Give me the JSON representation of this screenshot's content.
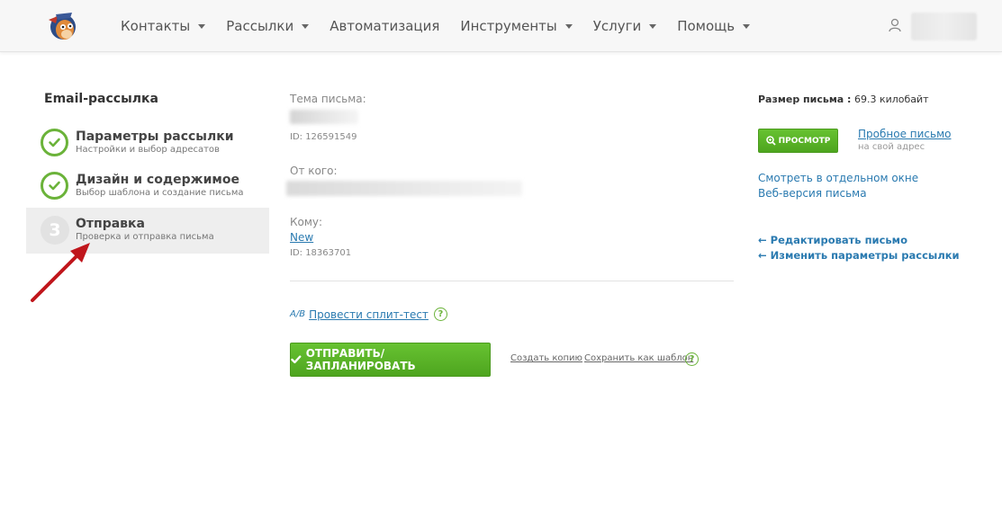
{
  "nav": {
    "items": [
      {
        "label": "Контакты",
        "dropdown": true
      },
      {
        "label": "Рассылки",
        "dropdown": true
      },
      {
        "label": "Автоматизация",
        "dropdown": false
      },
      {
        "label": "Инструменты",
        "dropdown": true
      },
      {
        "label": "Услуги",
        "dropdown": true
      },
      {
        "label": "Помощь",
        "dropdown": true
      }
    ]
  },
  "sidebar": {
    "title": "Email-рассылка",
    "steps": [
      {
        "title": "Параметры рассылки",
        "subtitle": "Настройки и выбор адресатов",
        "state": "done"
      },
      {
        "title": "Дизайн и содержимое",
        "subtitle": "Выбор шаблона и создание письма",
        "state": "done"
      },
      {
        "title": "Отправка",
        "subtitle": "Проверка и отправка письма",
        "state": "active",
        "number": "3"
      }
    ]
  },
  "main": {
    "subject_label": "Тема письма:",
    "subject_id": "ID: 126591549",
    "from_label": "От кого:",
    "to_label": "Кому:",
    "to_list": "New",
    "to_id": "ID: 18363701",
    "split_test": "Провести сплит-тест",
    "split_icon": "A/B",
    "send_button": "ОТПРАВИТЬ/ЗАПЛАНИРОВАТЬ",
    "copy_link": "Создать копию",
    "template_link": "Сохранить как шаблон",
    "help_glyph": "?"
  },
  "right": {
    "size_label": "Размер письма :",
    "size_value": "69.3 килобайт",
    "preview_button": "ПРОСМОТР",
    "test_email": "Пробное письмо",
    "test_email_sub": "на свой адрес",
    "open_window": "Смотреть в отдельном окне",
    "web_version": "Веб-версия письма",
    "edit_email": "Редактировать письмо",
    "edit_params": "Изменить параметры рассылки"
  },
  "colors": {
    "accent_green": "#5cb82a",
    "link_blue": "#2a7ab0",
    "arrow_red": "#c0161c"
  }
}
